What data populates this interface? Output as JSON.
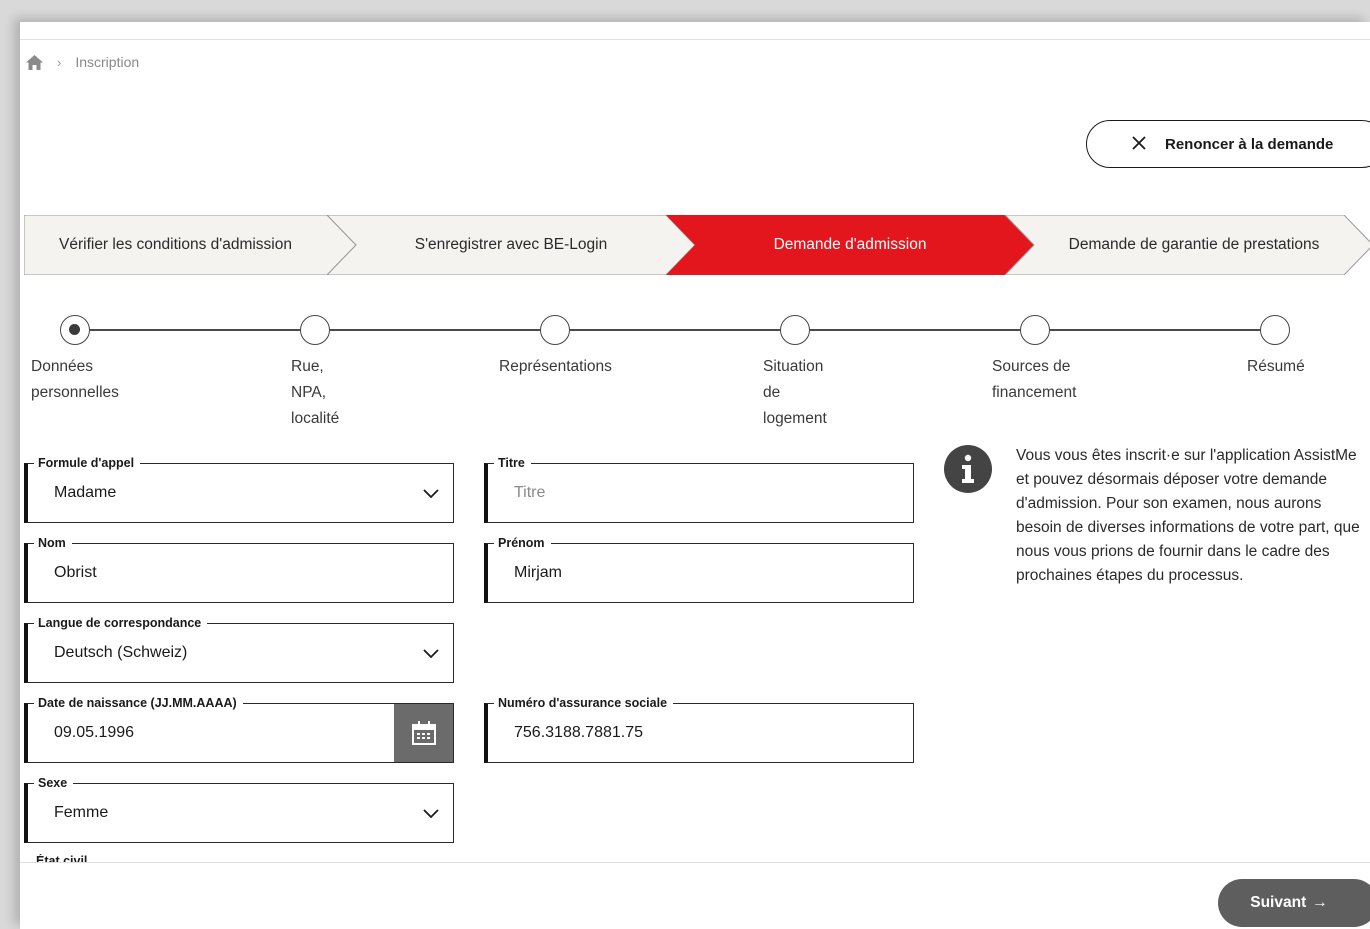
{
  "breadcrumb": {
    "current": "Inscription"
  },
  "cancel_button": {
    "label": "Renoncer à la demande"
  },
  "steps": [
    {
      "label": "Vérifier les conditions d'admission",
      "state": "done"
    },
    {
      "label": "S'enregistrer avec BE-Login",
      "state": "done"
    },
    {
      "label": "Demande d'admission",
      "state": "active"
    },
    {
      "label": "Demande de garantie de prestations",
      "state": "todo"
    }
  ],
  "progress": [
    {
      "line1": "Données",
      "line2": "personnelles",
      "line3": ""
    },
    {
      "line1": "Rue,",
      "line2": "NPA,",
      "line3": "localité"
    },
    {
      "line1": "Représentations",
      "line2": "",
      "line3": ""
    },
    {
      "line1": "Situation",
      "line2": "de",
      "line3": "logement"
    },
    {
      "line1": "Sources de",
      "line2": "financement",
      "line3": ""
    },
    {
      "line1": "Résumé",
      "line2": "",
      "line3": ""
    }
  ],
  "form": {
    "salutation": {
      "label": "Formule d'appel",
      "value": "Madame"
    },
    "title": {
      "label": "Titre",
      "placeholder": "Titre",
      "value": ""
    },
    "last_name": {
      "label": "Nom",
      "value": "Obrist"
    },
    "first_name": {
      "label": "Prénom",
      "value": "Mirjam"
    },
    "language": {
      "label": "Langue de correspondance",
      "value": "Deutsch (Schweiz)"
    },
    "birth_date": {
      "label": "Date de naissance (JJ.MM.AAAA)",
      "value": "09.05.1996"
    },
    "ssn": {
      "label": "Numéro d'assurance sociale",
      "value": "756.3188.7881.75"
    },
    "sex": {
      "label": "Sexe",
      "value": "Femme"
    },
    "civil_status": {
      "label": "État civil"
    }
  },
  "info": {
    "lines": [
      "Vous vous êtes inscrit·e sur l'application AssistMe",
      "et pouvez désormais déposer votre demande",
      "d'admission. Pour son examen, nous aurons",
      "besoin de diverses informations de votre part, que",
      "nous vous prions de fournir dans le cadre des",
      "prochaines étapes du processus."
    ]
  },
  "next_button": {
    "label": "Suivant",
    "arrow": "→"
  },
  "colors": {
    "active_step": "#e3151d",
    "step_bg": "#f5f3f0",
    "button_dark": "#5e5e5e"
  }
}
